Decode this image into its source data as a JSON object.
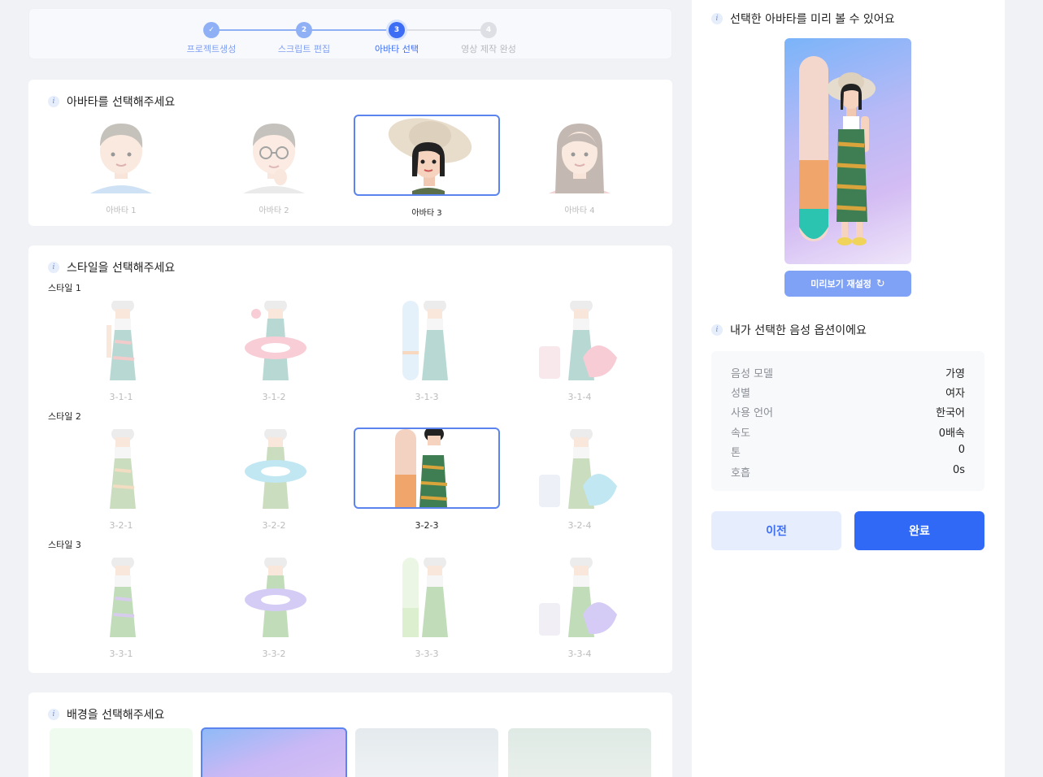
{
  "stepper": {
    "steps": [
      {
        "label": "프로젝트생성",
        "num": "✓",
        "state": "done"
      },
      {
        "label": "스크립트 편집",
        "num": "2",
        "state": "done"
      },
      {
        "label": "아바타 선택",
        "num": "3",
        "state": "cur"
      },
      {
        "label": "영상 제작 완성",
        "num": "4",
        "state": "todo"
      }
    ]
  },
  "avatar_section": {
    "title": "아바타를 선택해주세요",
    "items": [
      {
        "label": "아바타 1"
      },
      {
        "label": "아바타 2"
      },
      {
        "label": "아바타 3"
      },
      {
        "label": "아바타 4"
      }
    ],
    "selected": "아바타 3"
  },
  "style_section": {
    "title": "스타일을 선택해주세요",
    "groups": [
      {
        "label": "스타일 1",
        "items": [
          "3-1-1",
          "3-1-2",
          "3-1-3",
          "3-1-4"
        ]
      },
      {
        "label": "스타일 2",
        "items": [
          "3-2-1",
          "3-2-2",
          "3-2-3",
          "3-2-4"
        ]
      },
      {
        "label": "스타일 3",
        "items": [
          "3-3-1",
          "3-3-2",
          "3-3-3",
          "3-3-4"
        ]
      }
    ],
    "selected": "3-2-3"
  },
  "background_section": {
    "title": "배경을 선택해주세요"
  },
  "preview": {
    "title": "선택한 아바타를 미리 볼 수 있어요",
    "reset_label": "미리보기 재설정",
    "reset_icon": "refresh-icon"
  },
  "voice": {
    "title": "내가 선택한 음성 옵션이에요",
    "rows": [
      {
        "key": "음성 모델",
        "value": "가영"
      },
      {
        "key": "성별",
        "value": "여자"
      },
      {
        "key": "사용 언어",
        "value": "한국어"
      },
      {
        "key": "속도",
        "value": "0배속"
      },
      {
        "key": "톤",
        "value": "0"
      },
      {
        "key": "호흡",
        "value": "0s"
      }
    ]
  },
  "actions": {
    "prev_label": "이전",
    "done_label": "완료"
  },
  "colors": {
    "accent": "#2f69f6",
    "accent_light": "#7fa2f7",
    "selected_border": "#5b84ee"
  }
}
